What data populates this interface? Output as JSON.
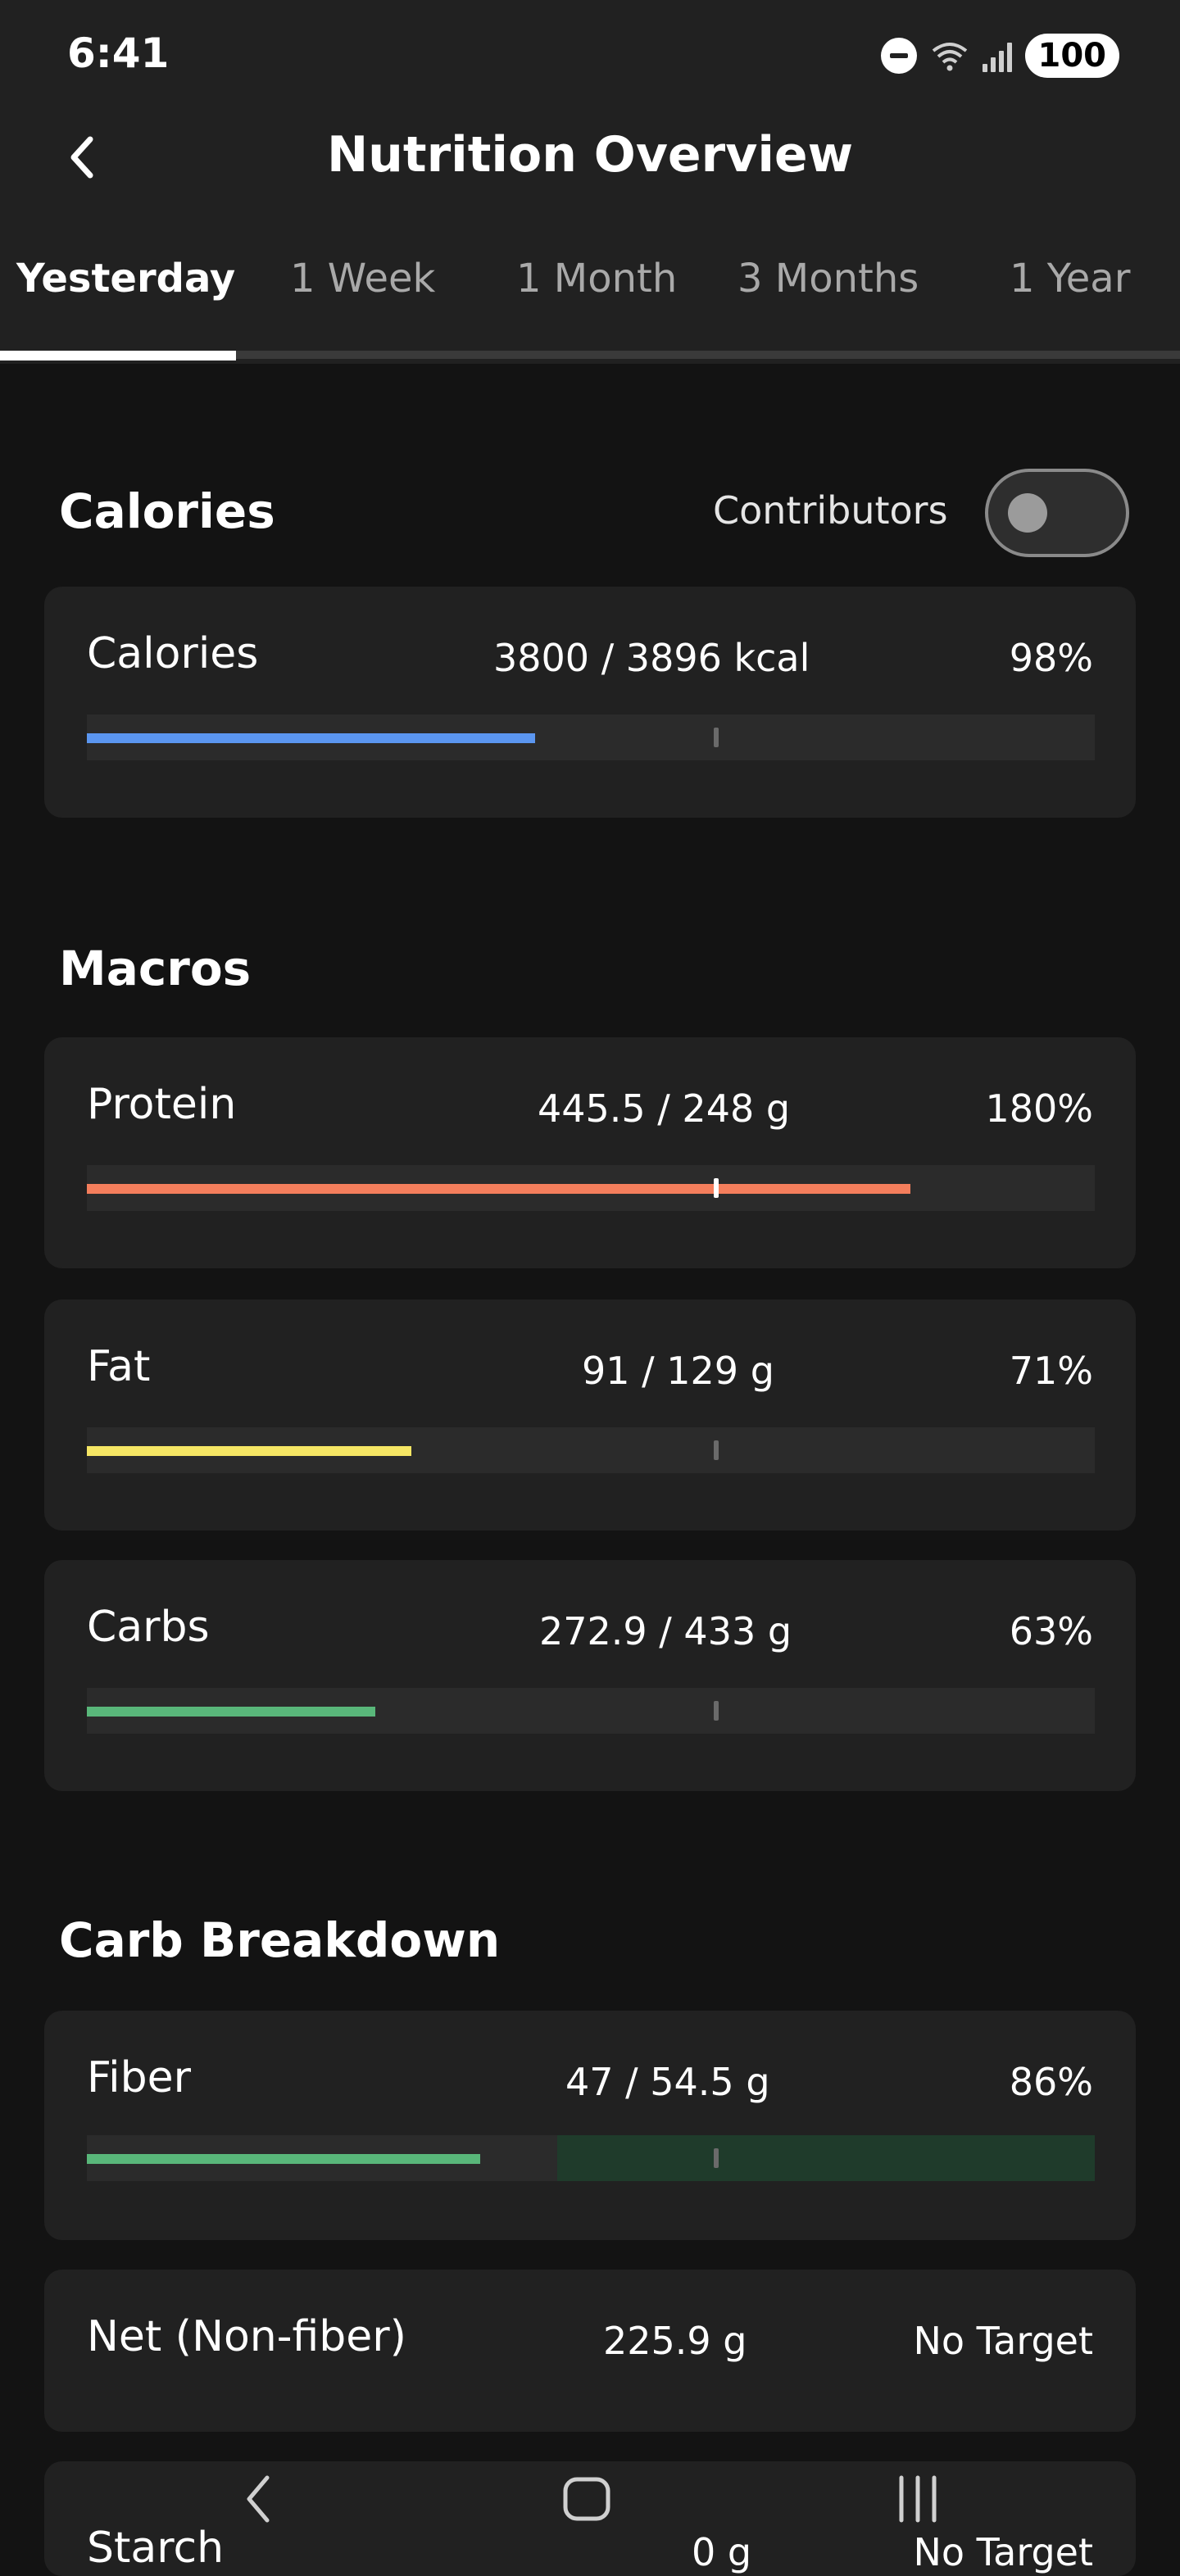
{
  "status_bar": {
    "time": "6:41",
    "battery": "100"
  },
  "header": {
    "title": "Nutrition Overview"
  },
  "tabs": [
    "Yesterday",
    "1 Week",
    "1 Month",
    "3 Months",
    "1 Year"
  ],
  "active_tab": "Yesterday",
  "calories_section": {
    "title": "Calories",
    "contributors_label": "Contributors",
    "contributors_on": false,
    "card": {
      "label": "Calories",
      "amount": "3800 / 3896 kcal",
      "percent": "98%",
      "progress": 0.98
    }
  },
  "macros_section": {
    "title": "Macros",
    "items": [
      {
        "label": "Protein",
        "amount": "445.5 / 248 g",
        "percent": "180%",
        "progress": 1.8
      },
      {
        "label": "Fat",
        "amount": "91 / 129 g",
        "percent": "71%",
        "progress": 0.71
      },
      {
        "label": "Carbs",
        "amount": "272.9 / 433 g",
        "percent": "63%",
        "progress": 0.63
      }
    ]
  },
  "carb_breakdown_section": {
    "title": "Carb Breakdown",
    "items": [
      {
        "label": "Fiber",
        "amount": "47 / 54.5 g",
        "percent": "86%",
        "progress": 0.86
      },
      {
        "label": "Net (Non-fiber)",
        "amount": "225.9 g",
        "target": "No Target"
      },
      {
        "label": "Starch",
        "amount": "0 g",
        "target": "No Target"
      }
    ]
  },
  "colors": {
    "background": "#131313",
    "card": "#212121",
    "calories": "#5b96f0",
    "protein": "#f47e5c",
    "fat": "#f5e664",
    "carbs": "#59b77a",
    "fiber_zone": "#1f3b2b"
  },
  "nav_icons": [
    "back-icon",
    "home-icon",
    "recents-icon"
  ]
}
